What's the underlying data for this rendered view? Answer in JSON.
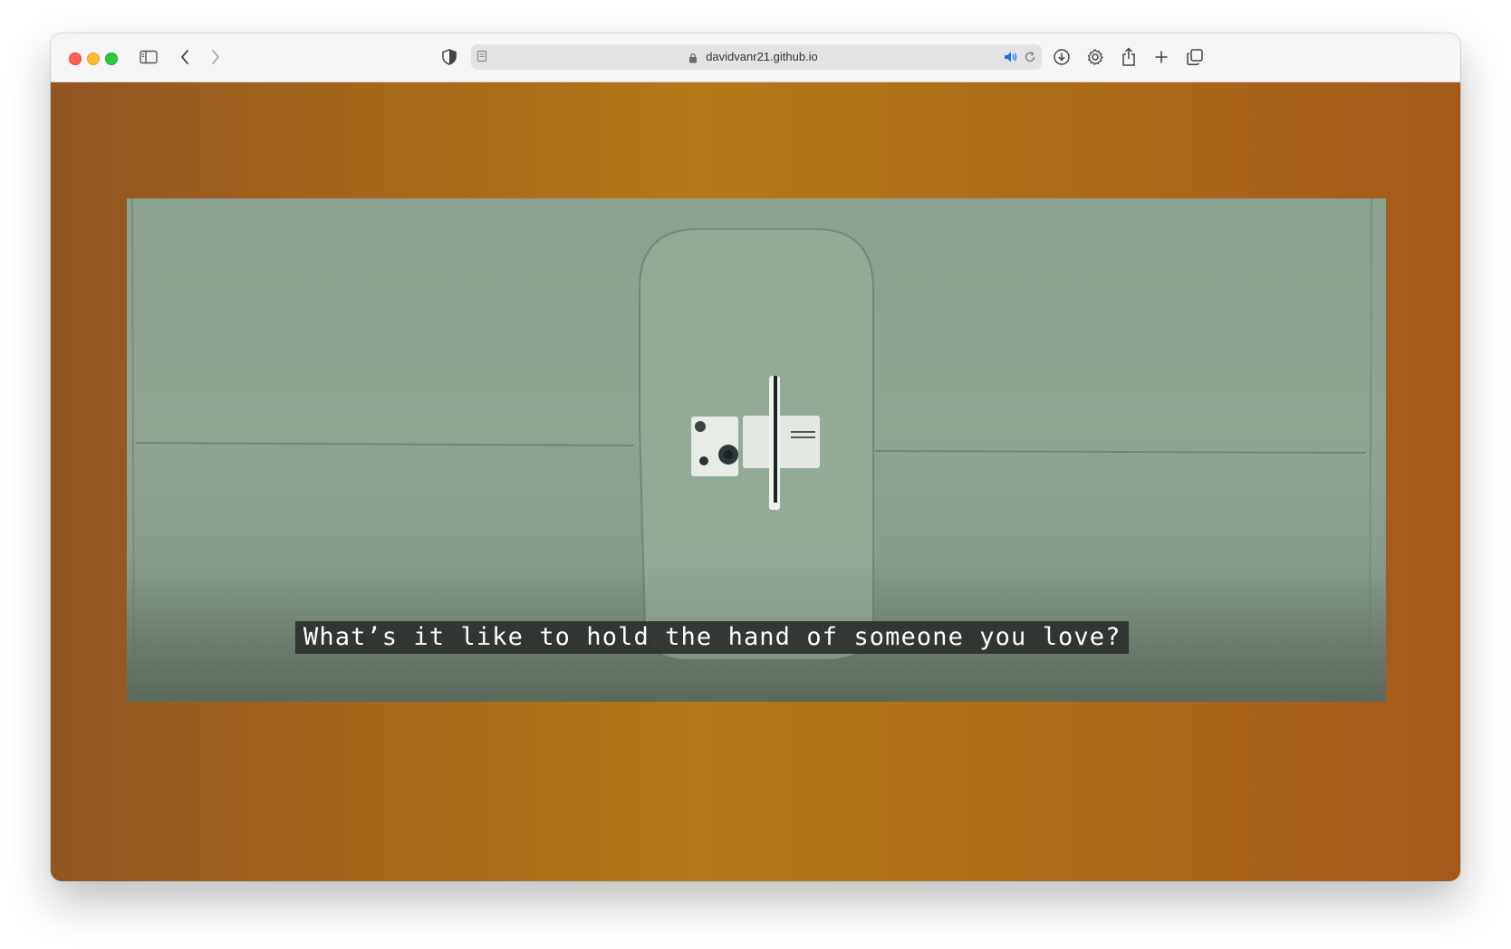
{
  "browser": {
    "url": "davidvanr21.github.io",
    "icons": {
      "sidebar": "sidebar-icon",
      "back": "chevron-left-icon",
      "forward": "chevron-right-icon",
      "privacy": "shield-icon",
      "page": "page-icon",
      "lock": "lock-icon",
      "audio": "speaker-icon",
      "reload": "reload-icon",
      "downloads": "download-icon",
      "settings": "gear-icon",
      "share": "share-icon",
      "new_tab": "plus-icon",
      "tabs": "tab-overview-icon"
    }
  },
  "page": {
    "background_colors": [
      "#925421",
      "#b57818",
      "#a4591b"
    ],
    "video": {
      "subtitle": "What’s it like to hold the hand of someone you love?"
    }
  }
}
